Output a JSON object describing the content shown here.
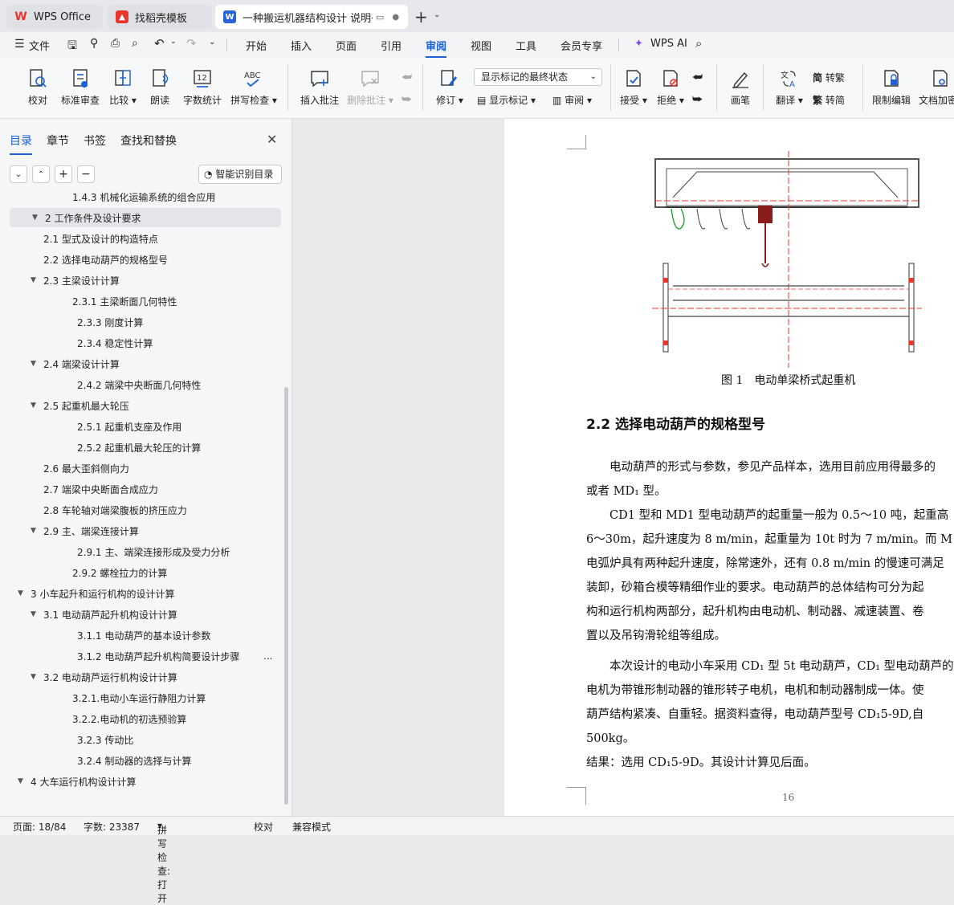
{
  "tabs": [
    {
      "label": "WPS Office"
    },
    {
      "label": "找稻壳模板"
    },
    {
      "label": "一种搬运机器结构设计 说明书"
    }
  ],
  "menu": {
    "file": "文件",
    "items": [
      "开始",
      "插入",
      "页面",
      "引用",
      "审阅",
      "视图",
      "工具",
      "会员专享"
    ],
    "active": "审阅",
    "wps_ai": "WPS AI"
  },
  "ribbon": {
    "proofread": "校对",
    "standard_review": "标准审查",
    "compare": "比较",
    "read_aloud": "朗读",
    "word_count": "字数统计",
    "spell_check": "拼写检查",
    "insert_comment": "插入批注",
    "delete_comment": "删除批注",
    "revise": "修订",
    "display_state": "显示标记的最终状态",
    "show_markup": "显示标记",
    "review": "审阅",
    "accept": "接受",
    "reject": "拒绝",
    "pen": "画笔",
    "translate": "翻译",
    "to_traditional": "转繁",
    "to_simplified": "转简",
    "restrict_edit": "限制编辑",
    "doc_encrypt": "文档加密"
  },
  "sidebar": {
    "tabs": [
      "目录",
      "章节",
      "书签",
      "查找和替换"
    ],
    "smart_toc": "智能识别目录",
    "toc": [
      {
        "label": "1.4.3 机械化运输系统的组合应用",
        "indent": 78,
        "toggle": ""
      },
      {
        "label": "2 工作条件及设计要求",
        "indent": 44,
        "toggle": "▼",
        "selected": true
      },
      {
        "label": "2.1 型式及设计的构造特点",
        "indent": 42,
        "toggle": ""
      },
      {
        "label": "2.2 选择电动葫芦的规格型号",
        "indent": 42,
        "toggle": ""
      },
      {
        "label": "2.3 主梁设计计算",
        "indent": 42,
        "toggle": "▼"
      },
      {
        "label": "2.3.1 主梁断面几何特性",
        "indent": 78,
        "toggle": ""
      },
      {
        "label": "2.3.3 刚度计算",
        "indent": 84,
        "toggle": ""
      },
      {
        "label": "2.3.4 稳定性计算",
        "indent": 84,
        "toggle": ""
      },
      {
        "label": "2.4 端梁设计计算",
        "indent": 42,
        "toggle": "▼"
      },
      {
        "label": "2.4.2 端梁中央断面几何特性",
        "indent": 84,
        "toggle": ""
      },
      {
        "label": "2.5 起重机最大轮压",
        "indent": 42,
        "toggle": "▼"
      },
      {
        "label": "2.5.1 起重机支座及作用",
        "indent": 84,
        "toggle": ""
      },
      {
        "label": "2.5.2 起重机最大轮压的计算",
        "indent": 84,
        "toggle": ""
      },
      {
        "label": "2.6 最大歪斜侧向力",
        "indent": 42,
        "toggle": ""
      },
      {
        "label": "2.7 端梁中央断面合成应力",
        "indent": 42,
        "toggle": ""
      },
      {
        "label": "2.8 车轮轴对端梁腹板的挤压应力",
        "indent": 42,
        "toggle": ""
      },
      {
        "label": "2.9 主、端梁连接计算",
        "indent": 42,
        "toggle": "▼"
      },
      {
        "label": "2.9.1 主、端梁连接形成及受力分析",
        "indent": 84,
        "toggle": ""
      },
      {
        "label": "2.9.2 螺栓拉力的计算",
        "indent": 78,
        "toggle": ""
      },
      {
        "label": "3 小车起升和运行机构的设计计算",
        "indent": 26,
        "toggle": "▼"
      },
      {
        "label": "3.1 电动葫芦起升机构设计计算",
        "indent": 42,
        "toggle": "▼"
      },
      {
        "label": "3.1.1 电动葫芦的基本设计参数",
        "indent": 84,
        "toggle": ""
      },
      {
        "label": "3.1.2 电动葫芦起升机构简要设计步骤",
        "indent": 84,
        "toggle": "",
        "more": "..."
      },
      {
        "label": "3.2 电动葫芦运行机构设计计算",
        "indent": 42,
        "toggle": "▼"
      },
      {
        "label": "3.2.1.电动小车运行静阻力计算",
        "indent": 78,
        "toggle": ""
      },
      {
        "label": "3.2.2.电动机的初选预验算",
        "indent": 78,
        "toggle": ""
      },
      {
        "label": "3.2.3 传动比",
        "indent": 84,
        "toggle": ""
      },
      {
        "label": "3.2.4 制动器的选择与计算",
        "indent": 84,
        "toggle": ""
      },
      {
        "label": "4 大车运行机构设计计算",
        "indent": 26,
        "toggle": "▼"
      }
    ]
  },
  "doc": {
    "figure_caption": "图 1　电动单梁桥式起重机",
    "heading": "2.2  选择电动葫芦的规格型号",
    "lines": [
      "　　电动葫芦的形式与参数，参见产品样本，选用目前应用得最多的",
      "或者 MD₁ 型。",
      "　　CD1 型和 MD1 型电动葫芦的起重量一般为 0.5～10 吨，起重高",
      "6～30m，起升速度为 8 m/min，起重量为 10t 时为 7 m/min。而 M",
      "电弧炉具有两种起升速度，除常速外，还有 0.8 m/min 的慢速可满足",
      "装卸，砂箱合模等精细作业的要求。电动葫芦的总体结构可分为起",
      "构和运行机构两部分，起升机构由电动机、制动器、减速装置、卷",
      "置以及吊钩滑轮组等组成。",
      "　　本次设计的电动小车采用 CD₁ 型 5t 电动葫芦，CD₁ 型电动葫芦的",
      "电机为带锥形制动器的锥形转子电机，电机和制动器制成一体。使",
      "葫芦结构紧凑、自重轻。据资料查得，电动葫芦型号 CD₁5-9D,自",
      "500kg。",
      "结果：选用 CD₁5-9D。其设计计算见后面。"
    ],
    "page_number": "16"
  },
  "status": {
    "page": "页面: 18/84",
    "words": "字数: 23387",
    "spell": "拼写检查: 打开",
    "proof": "校对",
    "compat": "兼容模式"
  },
  "colors": {
    "accent": "#1b5fd9",
    "wps_red": "#e8352e",
    "writer_blue": "#2b62d8"
  }
}
